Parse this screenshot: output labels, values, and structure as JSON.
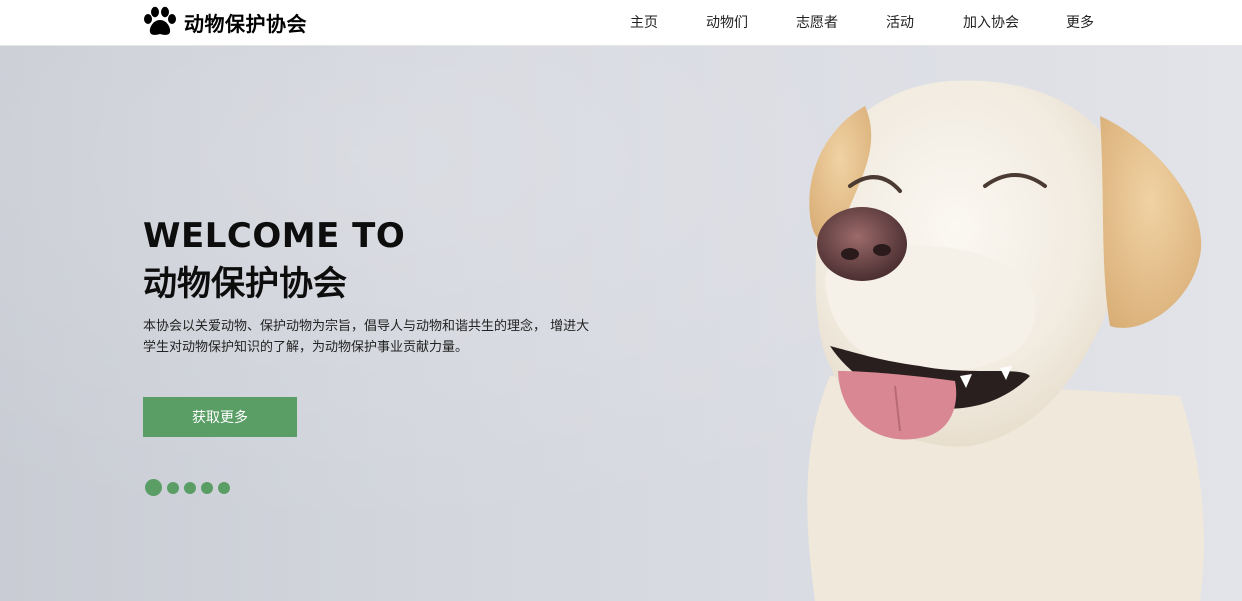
{
  "brand": {
    "name": "动物保护协会",
    "icon": "paw-icon"
  },
  "nav": [
    {
      "label": "主页"
    },
    {
      "label": "动物们"
    },
    {
      "label": "志愿者"
    },
    {
      "label": "活动"
    },
    {
      "label": "加入协会"
    },
    {
      "label": "更多"
    }
  ],
  "hero": {
    "welcome": "WELCOME TO",
    "title": "动物保护协会",
    "description_line1": "本协会以关爱动物、保护动物为宗旨，倡导人与动物和谐共生的理念， 增进大",
    "description_line2": "学生对动物保护知识的了解，为动物保护事业贡献力量。",
    "cta_label": "获取更多",
    "slides": 5,
    "active_slide": 1
  },
  "colors": {
    "accent": "#5a9e66",
    "hero_bg": "#d3d6dd"
  }
}
